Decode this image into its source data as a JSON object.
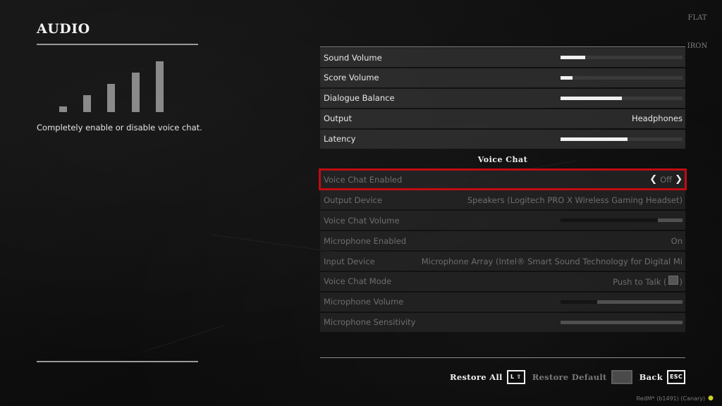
{
  "header": {
    "title": "AUDIO",
    "logo_text": "FLAT IRON"
  },
  "left_panel": {
    "signal_icon": "signal-strength-icon",
    "signal_bars": 5,
    "description": "Completely enable or disable voice chat."
  },
  "settings": {
    "sound_volume": {
      "label": "Sound Volume",
      "level": 0.2
    },
    "score_volume": {
      "label": "Score Volume",
      "level": 0.1
    },
    "dialogue_balance": {
      "label": "Dialogue Balance",
      "level": 0.5
    },
    "output": {
      "label": "Output",
      "value": "Headphones"
    },
    "latency": {
      "label": "Latency",
      "level": 0.55
    },
    "voice_chat_header": "Voice Chat",
    "voice_chat_enabled": {
      "label": "Voice Chat Enabled",
      "value": "Off"
    },
    "output_device": {
      "label": "Output Device",
      "value": "Speakers (Logitech PRO X Wireless Gaming Headset)"
    },
    "voice_chat_volume": {
      "label": "Voice Chat Volume",
      "level": 0.8
    },
    "microphone_enabled": {
      "label": "Microphone Enabled",
      "value": "On"
    },
    "input_device": {
      "label": "Input Device",
      "value": "Microphone Array (Intel® Smart Sound Technology for Digital Mi"
    },
    "voice_chat_mode": {
      "label": "Voice Chat Mode",
      "value_prefix": "Push to Talk (",
      "value_key": "",
      "value_suffix": ")"
    },
    "microphone_volume": {
      "label": "Microphone Volume",
      "level": 0.3
    },
    "microphone_sensitivity": {
      "label": "Microphone Sensitivity",
      "level": 0.0
    }
  },
  "footer": {
    "restore_all": {
      "label": "Restore All",
      "key": "L ⇧"
    },
    "restore_default": {
      "label": "Restore Default",
      "key": ""
    },
    "back": {
      "label": "Back",
      "key": "ESC"
    }
  },
  "build_info": "RedM* (b1491) (Canary)",
  "colors": {
    "selection": "#c00c12",
    "accent_leaf": "#cdd02a"
  }
}
